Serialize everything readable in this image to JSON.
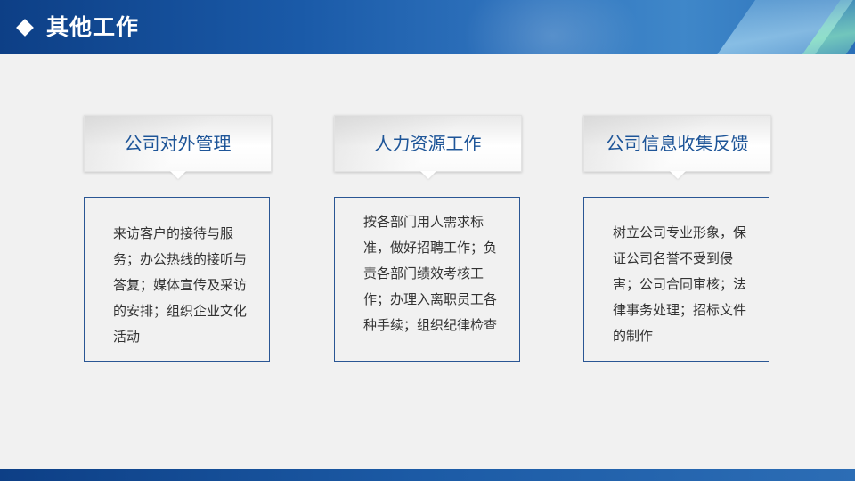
{
  "header": {
    "title": "其他工作"
  },
  "columns": [
    {
      "title": "公司对外管理",
      "text": "来访客户的接待与服务；办公热线的接听与答复；媒体宣传及采访的安排；组织企业文化活动"
    },
    {
      "title": "人力资源工作",
      "text": "按各部门用人需求标准，做好招聘工作；负责各部门绩效考核工作；办理入离职员工各种手续；组织纪律检查"
    },
    {
      "title": "公司信息收集反馈",
      "text": "树立公司专业形象，保证公司名誉不受到侵害；公司合同审核；法律事务处理；招标文件的制作"
    }
  ],
  "colors": {
    "header_dark": "#0d3f86",
    "header_light": "#3f87c9",
    "title_blue": "#1e5598",
    "box_border": "#2a5694",
    "background": "#f1f1f1"
  }
}
